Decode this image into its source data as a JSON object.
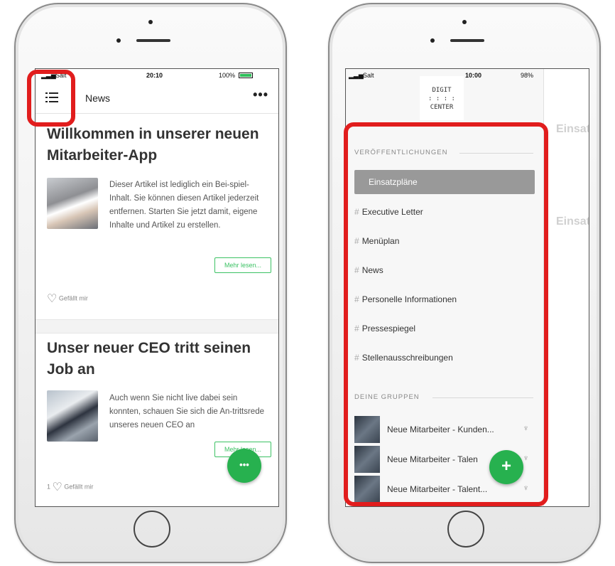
{
  "left_phone": {
    "status": {
      "carrier": "Salt",
      "time": "20:10",
      "battery": "100%",
      "battery_level": 1.0
    },
    "navbar": {
      "title": "News",
      "menu_icon": "hamburger-list-icon",
      "more_icon": "more-dots-icon",
      "more_label": "•••"
    },
    "articles": [
      {
        "title": "Willkommen in unserer neuen Mitarbeiter-App",
        "excerpt": "Dieser Artikel ist lediglich ein Bei-spiel-Inhalt. Sie können diesen Artikel jederzeit entfernen. Starten Sie jetzt damit, eigene Inhalte und Artikel zu erstellen.",
        "more_label": "Mehr lesen...",
        "like_count": "",
        "like_label": "Gefällt mir"
      },
      {
        "title": "Unser neuer CEO tritt seinen Job an",
        "excerpt": "Auch wenn Sie nicht live dabei sein konnten, schauen Sie sich die An-trittsrede unseres neuen CEO an",
        "more_label": "Mehr lesen...",
        "like_count": "1",
        "like_label": "Gefällt mir"
      }
    ],
    "fab_label": "•••"
  },
  "right_phone": {
    "status": {
      "carrier": "Salt",
      "time": "10:00",
      "battery": "98%",
      "battery_level": 0.98
    },
    "logo_lines": [
      "DIGIT",
      ": : : :",
      "CENTER"
    ],
    "sections": {
      "publications": "VERÖFFENTLICHUNGEN",
      "groups": "DEINE GRUPPEN"
    },
    "menu_items": [
      "Einsatzpläne",
      "Executive Letter",
      "Menüplan",
      "News",
      "Personelle Informationen",
      "Pressespiegel",
      "Stellenausschreibungen"
    ],
    "hash": "#",
    "groups": [
      "Neue Mitarbeiter - Kunden...",
      "Neue Mitarbeiter - Talen",
      "Neue Mitarbeiter - Talent..."
    ],
    "group_icon": "trophy-icon",
    "background_titles": [
      "Einsat",
      "Einsat"
    ],
    "fab_label": "+"
  },
  "colors": {
    "accent": "#27b14f",
    "highlight": "#e11d1d",
    "active_item": "#999999"
  }
}
